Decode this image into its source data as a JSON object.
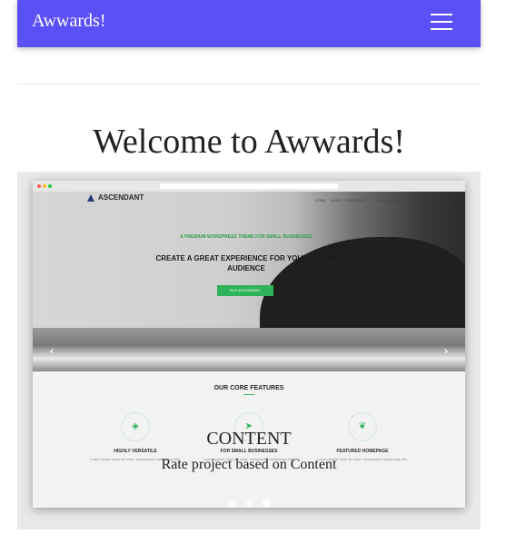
{
  "navbar": {
    "brand": "Awwards!",
    "menu_icon": "hamburger-menu-icon",
    "background": "#5b4ff6"
  },
  "page": {
    "title": "Welcome to Awwards!"
  },
  "carousel": {
    "prev_icon": "chevron-left-icon",
    "next_icon": "chevron-right-icon",
    "slide_count": 3,
    "active_index": 2,
    "slide": {
      "caption_title": "CONTENT",
      "caption_text": "Rate project based on Content",
      "screenshot": {
        "logo_text": "ASCENDANT",
        "nav": [
          "HOME",
          "BLOG",
          "FEATURES ⌄",
          "PAGE TEMPLATES ⌄"
        ],
        "tagline": "A PREMIUM WORDPRESS THEME FOR SMALL BUSINESSES",
        "headline": "CREATE A GREAT EXPERIENCE FOR YOUR DREAM AUDIENCE",
        "button": "BUY ASCENDANT",
        "section_title": "OUR CORE FEATURES",
        "features": [
          {
            "icon": "layers-icon",
            "title": "HIGHLY VERSATILE",
            "text": "Lorem ipsum dolor sit amet, consectetur sadipscing elitr."
          },
          {
            "icon": "cursor-icon",
            "title": "FOR SMALL BUSINESSES",
            "text": "Lorem ipsum dolor sit amet, consectetur sadipscing elitr."
          },
          {
            "icon": "leaf-icon",
            "title": "FEATURED HOMEPAGE",
            "text": "Lorem ipsum dolor sit amet, consectetur sadipscing elitr."
          }
        ]
      }
    }
  }
}
